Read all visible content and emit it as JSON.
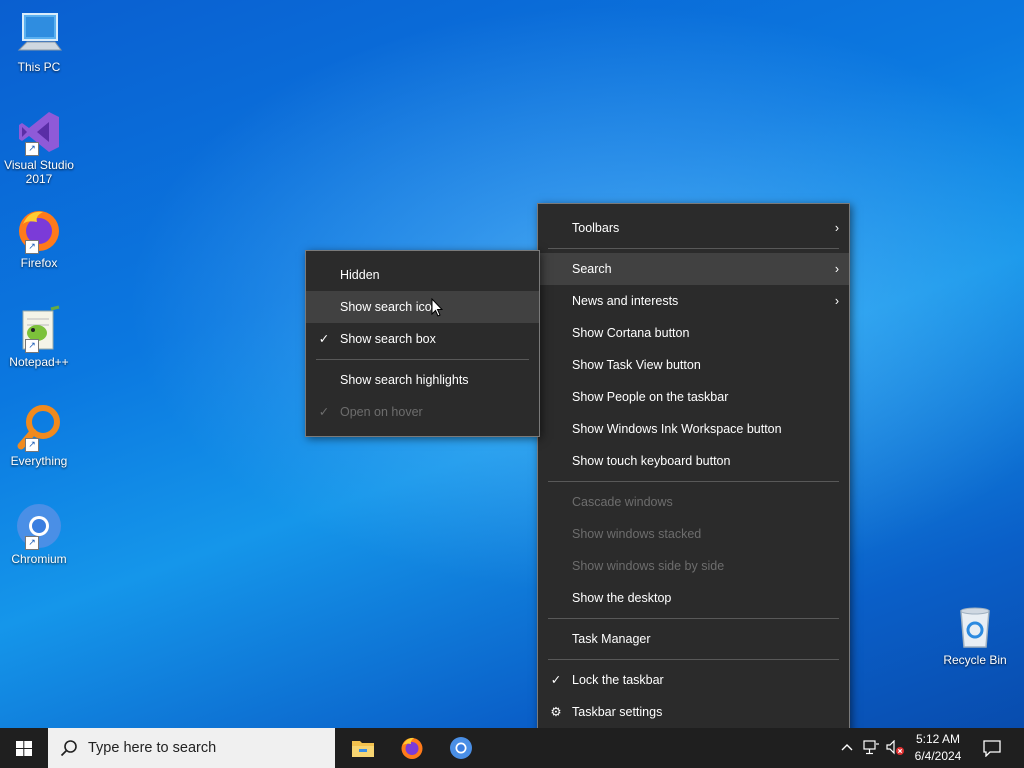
{
  "desktop": {
    "icons": [
      {
        "label": "This PC",
        "icon": "computer-icon"
      },
      {
        "label": "Visual Studio 2017",
        "icon": "visual-studio-icon"
      },
      {
        "label": "Firefox",
        "icon": "firefox-icon"
      },
      {
        "label": "Notepad++",
        "icon": "notepadpp-icon"
      },
      {
        "label": "Everything",
        "icon": "everything-icon"
      },
      {
        "label": "Chromium",
        "icon": "chromium-icon"
      }
    ],
    "recycle_bin": {
      "label": "Recycle Bin",
      "icon": "recycle-bin-icon"
    }
  },
  "context_menu": {
    "items": [
      {
        "label": "Toolbars",
        "submenu": true
      },
      {
        "label": "Search",
        "submenu": true,
        "highlighted": true
      },
      {
        "label": "News and interests",
        "submenu": true
      },
      {
        "label": "Show Cortana button"
      },
      {
        "label": "Show Task View button"
      },
      {
        "label": "Show People on the taskbar"
      },
      {
        "label": "Show Windows Ink Workspace button"
      },
      {
        "label": "Show touch keyboard button"
      },
      {
        "label": "Cascade windows",
        "disabled": true
      },
      {
        "label": "Show windows stacked",
        "disabled": true
      },
      {
        "label": "Show windows side by side",
        "disabled": true
      },
      {
        "label": "Show the desktop"
      },
      {
        "label": "Task Manager"
      },
      {
        "label": "Lock the taskbar",
        "checked": true
      },
      {
        "label": "Taskbar settings",
        "icon": "gear-icon"
      }
    ]
  },
  "search_submenu": {
    "items": [
      {
        "label": "Hidden"
      },
      {
        "label": "Show search icon",
        "highlighted": true
      },
      {
        "label": "Show search box",
        "checked": true
      },
      {
        "label": "Show search highlights"
      },
      {
        "label": "Open on hover",
        "checked": true,
        "disabled": true
      }
    ]
  },
  "taskbar": {
    "search_placeholder": "Type here to search",
    "pinned": [
      "file-explorer-icon",
      "firefox-icon",
      "chromium-icon"
    ],
    "tray_icons": [
      "chevron-up-icon",
      "network-icon",
      "volume-muted-icon"
    ],
    "clock": {
      "time": "5:12 AM",
      "date": "6/4/2024"
    }
  },
  "glyphs": {
    "check": "✓",
    "arrow": "›",
    "gear": "⚙",
    "shortcut": "↗"
  },
  "colors": {
    "menu_bg": "#2b2b2b",
    "menu_highlight": "#414141",
    "disabled_text": "#6d6d6d",
    "taskbar_bg": "#1f1f1f"
  }
}
